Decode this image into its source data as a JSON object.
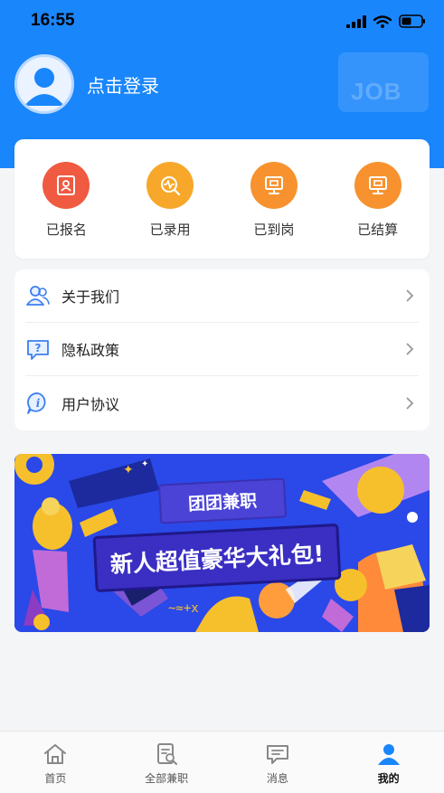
{
  "status_bar": {
    "time": "16:55"
  },
  "profile": {
    "login_text": "点击登录",
    "badge_text": "JOB"
  },
  "status_items": [
    {
      "label": "已报名",
      "icon": "id-card-icon",
      "color": "#ef5a41"
    },
    {
      "label": "已录用",
      "icon": "search-pulse-icon",
      "color": "#f7a82b"
    },
    {
      "label": "已到岗",
      "icon": "monitor-icon",
      "color": "#f7922f"
    },
    {
      "label": "已结算",
      "icon": "monitor-icon",
      "color": "#f7922f"
    }
  ],
  "menu": [
    {
      "label": "关于我们",
      "icon": "people-icon"
    },
    {
      "label": "隐私政策",
      "icon": "question-bubble-icon"
    },
    {
      "label": "用户协议",
      "icon": "info-bubble-icon"
    }
  ],
  "banner": {
    "title": "团团兼职",
    "subtitle": "新人超值豪华大礼包!"
  },
  "tabbar": [
    {
      "label": "首页",
      "icon": "home-icon",
      "active": false
    },
    {
      "label": "全部兼职",
      "icon": "job-list-icon",
      "active": false
    },
    {
      "label": "消息",
      "icon": "message-icon",
      "active": false
    },
    {
      "label": "我的",
      "icon": "user-icon",
      "active": true
    }
  ],
  "colors": {
    "primary": "#1a86fb",
    "active_tab": "#1a86fb"
  }
}
